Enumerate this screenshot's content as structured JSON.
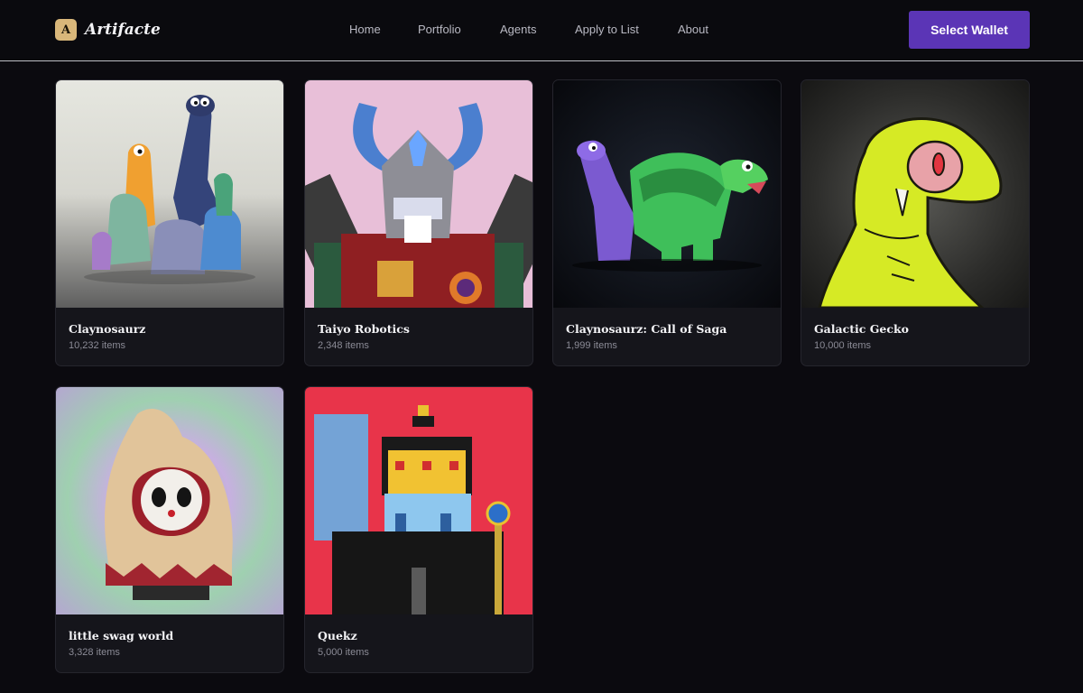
{
  "brand": {
    "logo_letter": "A",
    "name": "Artifacte"
  },
  "nav": {
    "items": [
      {
        "label": "Home"
      },
      {
        "label": "Portfolio"
      },
      {
        "label": "Agents"
      },
      {
        "label": "Apply to List"
      },
      {
        "label": "About"
      }
    ]
  },
  "wallet": {
    "label": "Select Wallet"
  },
  "collections": [
    {
      "name": "Claynosaurz",
      "count": "10,232 items"
    },
    {
      "name": "Taiyo Robotics",
      "count": "2,348 items"
    },
    {
      "name": "Claynosaurz: Call of Saga",
      "count": "1,999 items"
    },
    {
      "name": "Galactic Gecko",
      "count": "10,000 items"
    },
    {
      "name": "little swag world",
      "count": "3,328 items"
    },
    {
      "name": "Quekz",
      "count": "5,000 items"
    }
  ],
  "colors": {
    "accent": "#5b35b6",
    "brand_mark": "#d9b77a",
    "background": "#0b0a0f"
  }
}
